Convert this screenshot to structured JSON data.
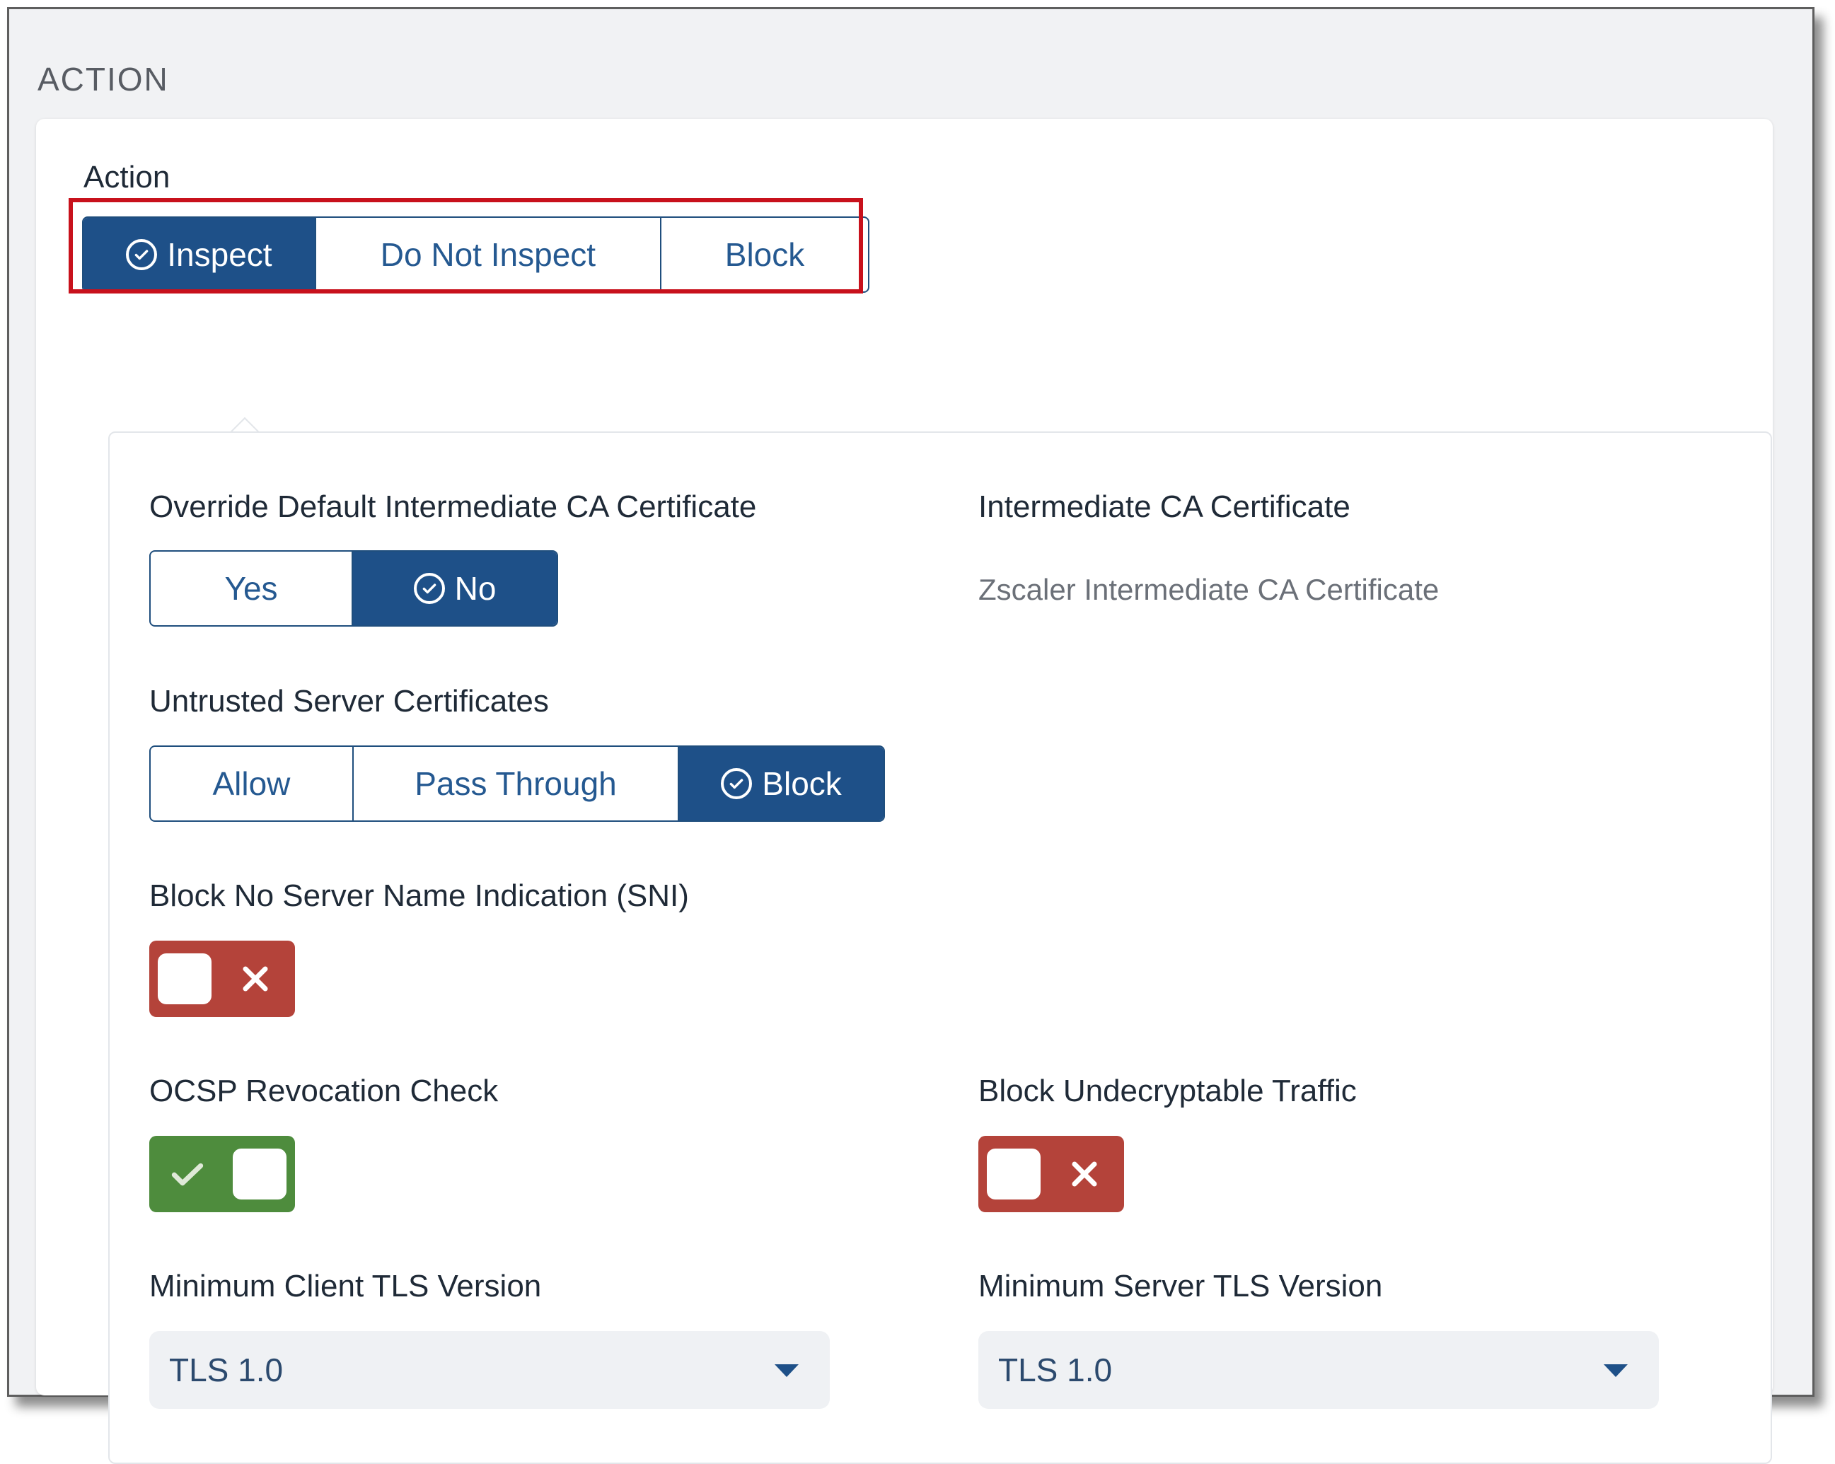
{
  "section_title": "ACTION",
  "action": {
    "label": "Action",
    "options": [
      "Inspect",
      "Do Not Inspect",
      "Block"
    ],
    "selected": "Inspect"
  },
  "override_ca": {
    "label": "Override Default Intermediate CA Certificate",
    "options": [
      "Yes",
      "No"
    ],
    "selected": "No"
  },
  "intermediate_ca": {
    "label": "Intermediate CA Certificate",
    "value": "Zscaler Intermediate CA Certificate"
  },
  "untrusted": {
    "label": "Untrusted Server Certificates",
    "options": [
      "Allow",
      "Pass Through",
      "Block"
    ],
    "selected": "Block"
  },
  "block_sni": {
    "label": "Block No Server Name Indication (SNI)",
    "enabled": false
  },
  "ocsp": {
    "label": "OCSP Revocation Check",
    "enabled": true
  },
  "block_undecryptable": {
    "label": "Block Undecryptable Traffic",
    "enabled": false
  },
  "min_client_tls": {
    "label": "Minimum Client TLS Version",
    "value": "TLS 1.0"
  },
  "min_server_tls": {
    "label": "Minimum Server TLS Version",
    "value": "TLS 1.0"
  },
  "colors": {
    "primary": "#1e5088",
    "toggle_off": "#b4433a",
    "toggle_on": "#4e8c3d",
    "highlight": "#c8111c"
  }
}
